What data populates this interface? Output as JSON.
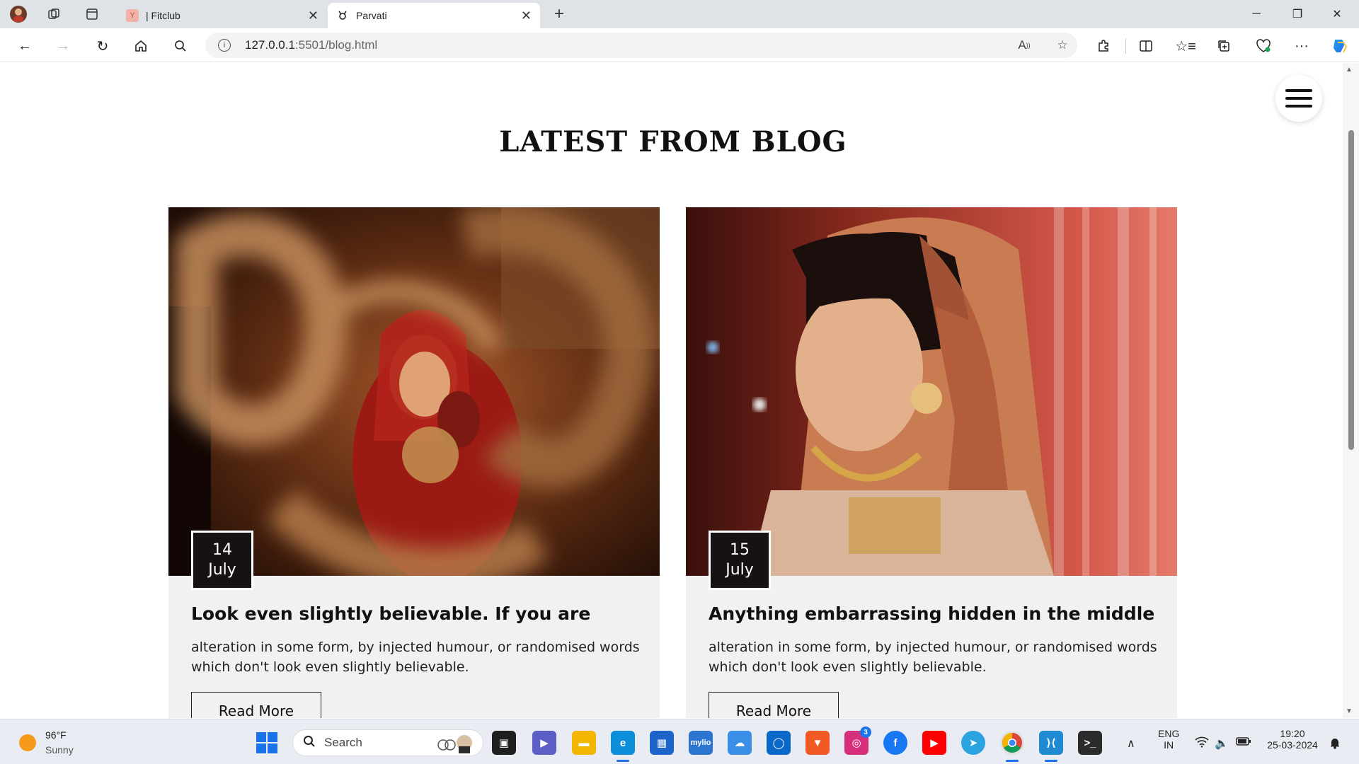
{
  "browser": {
    "tabs": [
      {
        "title": "| Fitclub",
        "active": false
      },
      {
        "title": "Parvati",
        "active": true
      }
    ],
    "url": {
      "host": "127.0.0.1",
      "rest": ":5501/blog.html"
    }
  },
  "page": {
    "section_title": "LATEST FROM BLOG",
    "posts": [
      {
        "day": "14",
        "month": "July",
        "title": "Look even slightly believable. If you are",
        "excerpt": "alteration in some form, by injected humour, or randomised words which don't look even slightly believable.",
        "button": "Read More"
      },
      {
        "day": "15",
        "month": "July",
        "title": "Anything embarrassing hidden in the middle",
        "excerpt": "alteration in some form, by injected humour, or randomised words which don't look even slightly believable.",
        "button": "Read More"
      }
    ]
  },
  "taskbar": {
    "weather": {
      "temp": "96°F",
      "condition": "Sunny"
    },
    "search_label": "Search",
    "instagram_badge": "3",
    "lang": {
      "line1": "ENG",
      "line2": "IN"
    },
    "time": "19:20",
    "date": "25-03-2024"
  },
  "colors": {
    "date_box": "#171212",
    "card_bg": "#f1f1f3",
    "accent": "#1a73e8"
  }
}
